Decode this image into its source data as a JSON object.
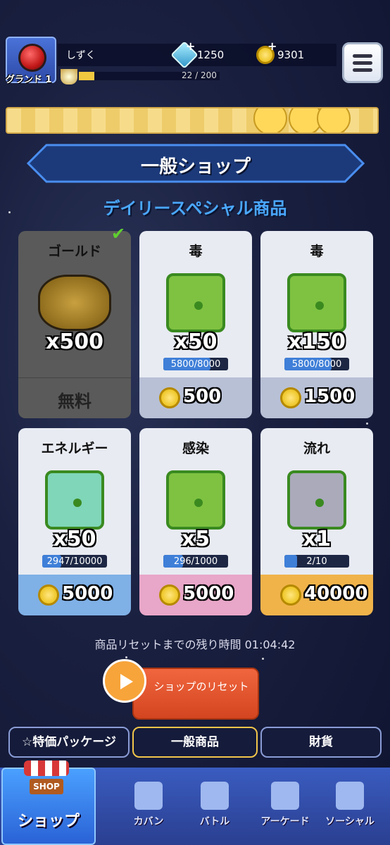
{
  "player": {
    "name": "しずく",
    "rank": "グランド 1",
    "gems": "1250",
    "coins": "9301",
    "xp": "22 / 200",
    "xp_fraction": 0.11
  },
  "header": {
    "title": "一般ショップ",
    "section": "デイリースペシャル商品"
  },
  "cards": [
    {
      "name": "ゴールド",
      "qty": "x500",
      "price": "無料",
      "claimed": true,
      "color": "#555"
    },
    {
      "name": "毒",
      "qty": "x50",
      "progress": "5800/8000",
      "progress_fraction": 0.725,
      "price": "500",
      "price_bg": "#b8c0d6",
      "dice_color": "#7fc241"
    },
    {
      "name": "毒",
      "qty": "x150",
      "progress": "5800/8000",
      "progress_fraction": 0.725,
      "price": "1500",
      "price_bg": "#b8c0d6",
      "dice_color": "#7fc241"
    },
    {
      "name": "エネルギー",
      "qty": "x50",
      "progress": "2947/10000",
      "progress_fraction": 0.29,
      "price": "5000",
      "price_bg": "#7fb0e6",
      "dice_color": "#7fd6b8"
    },
    {
      "name": "感染",
      "qty": "x5",
      "progress": "296/1000",
      "progress_fraction": 0.3,
      "price": "5000",
      "price_bg": "#e8a6c8",
      "dice_color": "#7fc241"
    },
    {
      "name": "流れ",
      "qty": "x1",
      "progress": "2/10",
      "progress_fraction": 0.2,
      "price": "40000",
      "price_bg": "#f0b34a",
      "dice_color": "#aab"
    }
  ],
  "reset": {
    "time_label": "商品リセットまでの残り時間 01:04:42",
    "button_label": "ショップのリセット"
  },
  "tabs": {
    "special": "特価パッケージ",
    "general": "一般商品",
    "currency": "財貨"
  },
  "nav": {
    "shop": "ショップ",
    "shop_sign": "SHOP",
    "bag": "カバン",
    "battle": "バトル",
    "arcade": "アーケード",
    "social": "ソーシャル"
  }
}
